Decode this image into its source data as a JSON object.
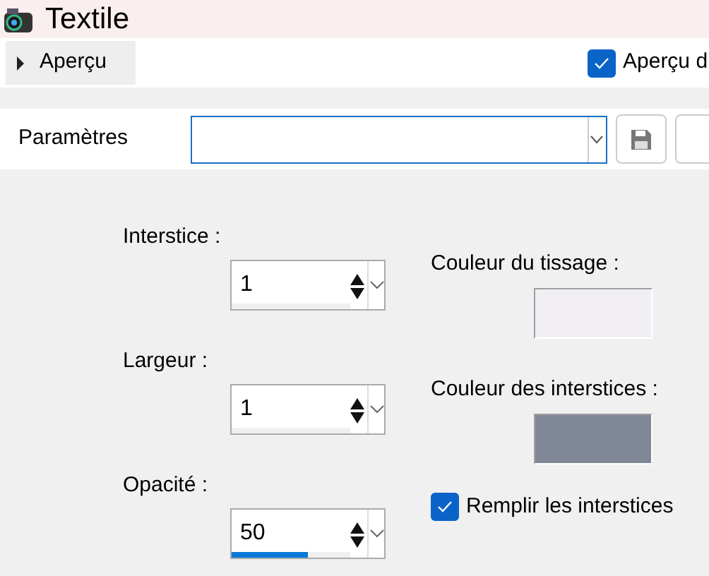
{
  "window": {
    "title": "Textile"
  },
  "preview_toggle": {
    "label": "Aperçu",
    "expanded": false
  },
  "preview_checkbox": {
    "label": "Aperçu d",
    "checked": true
  },
  "presets": {
    "label": "Paramètres"
  },
  "fields": [
    {
      "label": "Interstice :",
      "value": "1"
    },
    {
      "label": "Largeur :",
      "value": "1"
    },
    {
      "label": "Opacité :",
      "value": "50",
      "level": 0.5
    }
  ],
  "colors": [
    {
      "label": "Couleur du tissage :",
      "color": "#f2eff4"
    },
    {
      "label": "Couleur des interstices :",
      "color": "#808898"
    }
  ],
  "fill_checkbox": {
    "label": "Remplir les interstices",
    "checked": true
  }
}
